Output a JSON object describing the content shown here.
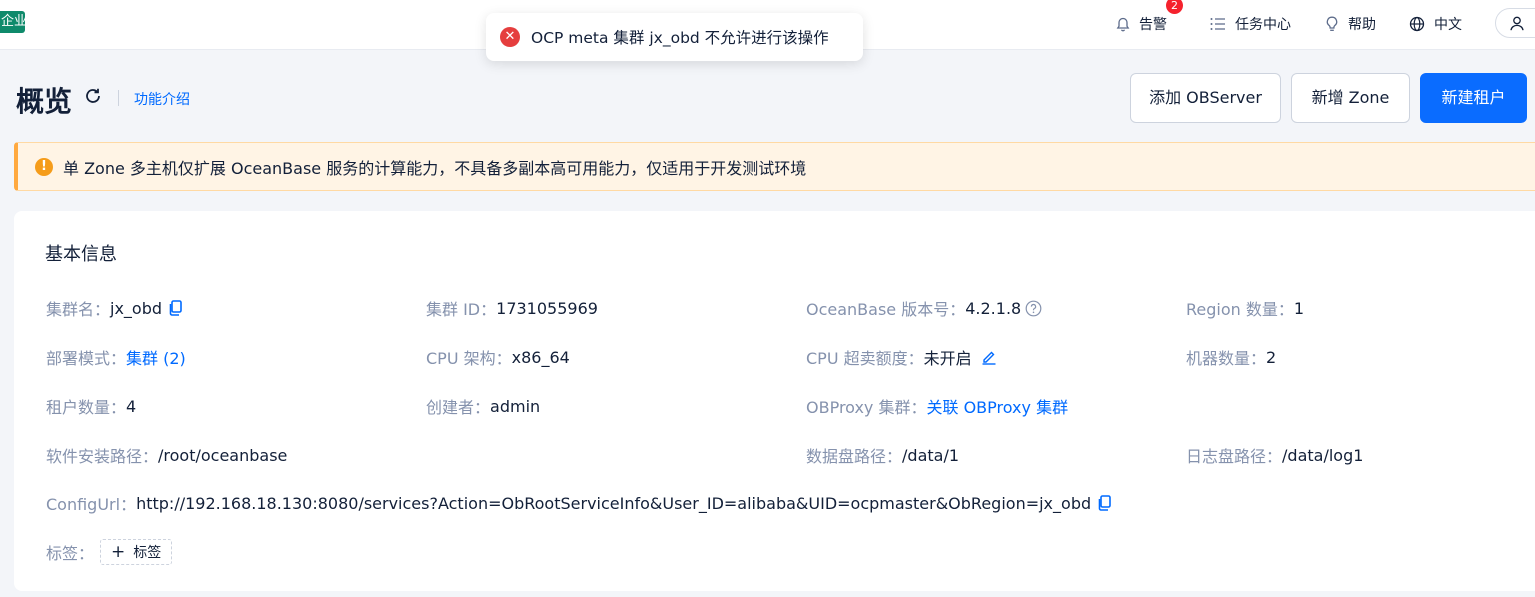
{
  "header": {
    "edition_badge": "企业版",
    "alarm_label": "告警",
    "alarm_count": "2",
    "tasks_label": "任务中心",
    "help_label": "帮助",
    "language_label": "中文"
  },
  "toast": {
    "message": "OCP meta 集群 jx_obd 不允许进行该操作"
  },
  "page": {
    "title": "概览",
    "intro_link": "功能介绍",
    "buttons": {
      "add_observer": "添加 OBServer",
      "add_zone": "新增 Zone",
      "new_tenant": "新建租户"
    }
  },
  "alert": {
    "message": "单 Zone 多主机仅扩展 OceanBase 服务的计算能力，不具备多副本高可用能力，仅适用于开发测试环境"
  },
  "basic_info": {
    "title": "基本信息",
    "cluster_name": {
      "label": "集群名：",
      "value": "jx_obd"
    },
    "cluster_id": {
      "label": "集群 ID：",
      "value": "1731055969"
    },
    "ob_version": {
      "label": "OceanBase 版本号：",
      "value": "4.2.1.8"
    },
    "region_count": {
      "label": "Region 数量：",
      "value": "1"
    },
    "deploy_mode": {
      "label": "部署模式：",
      "value": "集群 (2)"
    },
    "cpu_arch": {
      "label": "CPU 架构：",
      "value": "x86_64"
    },
    "cpu_oversell": {
      "label": "CPU 超卖额度：",
      "value": "未开启"
    },
    "machine_count": {
      "label": "机器数量：",
      "value": "2"
    },
    "tenant_count": {
      "label": "租户数量：",
      "value": "4"
    },
    "creator": {
      "label": "创建者：",
      "value": "admin"
    },
    "obproxy_cluster": {
      "label": "OBProxy 集群：",
      "value": "关联 OBProxy 集群"
    },
    "install_path": {
      "label": "软件安装路径：",
      "value": "/root/oceanbase"
    },
    "data_path": {
      "label": "数据盘路径：",
      "value": "/data/1"
    },
    "log_path": {
      "label": "日志盘路径：",
      "value": "/data/log1"
    },
    "config_url": {
      "label": "ConfigUrl：",
      "value": "http://192.168.18.130:8080/services?Action=ObRootServiceInfo&User_ID=alibaba&UID=ocpmaster&ObRegion=jx_obd"
    },
    "tags": {
      "label": "标签：",
      "add_label": "标签"
    }
  },
  "colors": {
    "primary": "#0a6cff",
    "link": "#006aff",
    "error": "#e53e3e",
    "warning": "#f59c1a",
    "badge_green": "#0f8a6b"
  }
}
